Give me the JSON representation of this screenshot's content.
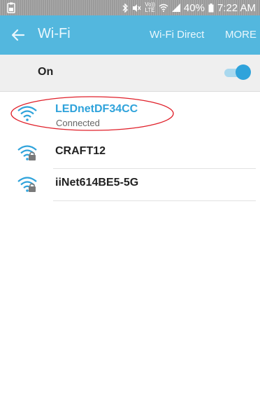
{
  "status_bar": {
    "battery_percent_text": "40%",
    "time": "7:22 AM",
    "lte_top": "Vo))",
    "lte_bottom": "LTE",
    "icons": [
      "screenshot-icon",
      "bluetooth-icon",
      "mute-icon",
      "volte-icon",
      "wifi-icon",
      "signal-icon",
      "battery-icon"
    ]
  },
  "app_bar": {
    "title": "Wi-Fi",
    "back_icon": "back-arrow-icon",
    "action_wifi_direct": "Wi-Fi Direct",
    "action_more": "MORE",
    "color": "#53b7de"
  },
  "wifi_toggle": {
    "label": "On",
    "state": "on",
    "accent_color": "#2fa3db"
  },
  "networks": [
    {
      "name": "LEDnetDF34CC",
      "status": "Connected",
      "secured": false,
      "connected": true
    },
    {
      "name": "CRAFT12",
      "status": "",
      "secured": true,
      "connected": false
    },
    {
      "name": "iiNet614BE5-5G",
      "status": "",
      "secured": true,
      "connected": false
    }
  ],
  "annotation": {
    "shape": "ellipse",
    "color": "#e0202a"
  }
}
